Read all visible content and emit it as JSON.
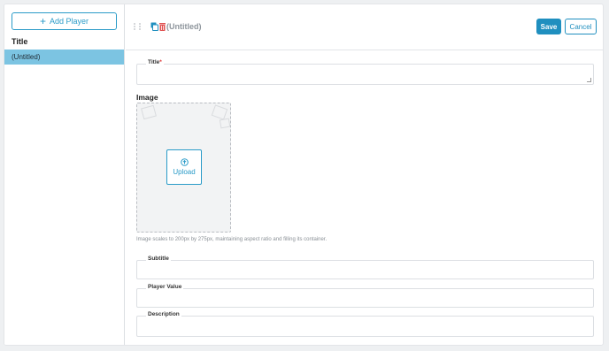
{
  "sidebar": {
    "add_button_label": "Add Player",
    "heading": "Title",
    "items": [
      {
        "label": "(Untitled)"
      }
    ]
  },
  "header": {
    "title": "(Untitled)",
    "save_label": "Save",
    "cancel_label": "Cancel"
  },
  "form": {
    "title_field": {
      "label": "Title",
      "required_mark": "*",
      "value": ""
    },
    "image": {
      "label": "Image",
      "upload_label": "Upload",
      "hint": "Image scales to 200px by 275px, maintaining aspect ratio and filling its container."
    },
    "subtitle_field": {
      "label": "Subtitle",
      "value": ""
    },
    "player_value_field": {
      "label": "Player Value",
      "value": ""
    },
    "description_field": {
      "label": "Description",
      "value": ""
    }
  },
  "colors": {
    "accent": "#2a9bc8",
    "save_bg": "#1f8fbf",
    "selected_row": "#7cc4e2",
    "delete_icon": "#e05252"
  },
  "icons": [
    "plus-icon",
    "drag-handle-icon",
    "duplicate-icon",
    "trash-icon",
    "upload-icon"
  ]
}
